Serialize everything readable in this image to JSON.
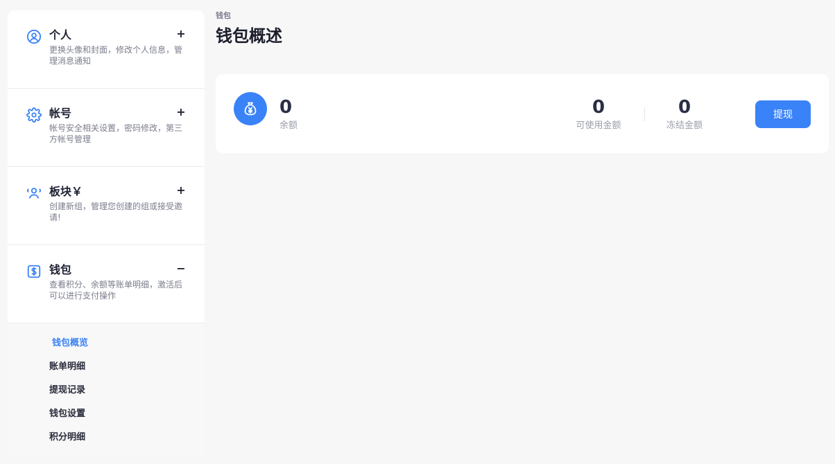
{
  "sidebar": {
    "sections": [
      {
        "title": "个人",
        "desc": "更换头像和封面，修改个人信息，管理消息通知",
        "toggle": "+",
        "icon": "user-circle-icon"
      },
      {
        "title": "帐号",
        "desc": "帐号安全相关设置，密码修改，第三方帐号管理",
        "toggle": "+",
        "icon": "gear-icon"
      },
      {
        "title": "板块￥",
        "desc": "创建新组，管理您创建的组或接受邀请!",
        "toggle": "+",
        "icon": "users-icon"
      },
      {
        "title": "钱包",
        "desc": "查看积分、余额等账单明细，激活后可以进行支付操作",
        "toggle": "−",
        "icon": "dollar-icon"
      }
    ],
    "submenu": [
      "钱包概览",
      "账单明细",
      "提现记录",
      "钱包设置",
      "积分明细"
    ],
    "active_submenu": "钱包概览"
  },
  "breadcrumb": "钱包",
  "page_title": "钱包概述",
  "wallet": {
    "balance_value": "0",
    "balance_label": "余额",
    "available_value": "0",
    "available_label": "可使用金额",
    "frozen_value": "0",
    "frozen_label": "冻结金额",
    "withdraw_label": "提现",
    "icon": "money-bag-icon"
  },
  "colors": {
    "accent": "#3a82f7",
    "background": "#f7f7f8",
    "card": "#ffffff"
  }
}
